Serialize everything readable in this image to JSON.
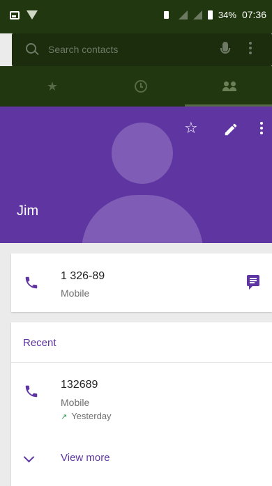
{
  "status_bar": {
    "battery": "34%",
    "time": "07:36"
  },
  "search": {
    "placeholder": "Search contacts"
  },
  "tabs": [
    {
      "icon": "star-icon",
      "selected": false
    },
    {
      "icon": "clock-icon",
      "selected": false
    },
    {
      "icon": "people-icon",
      "selected": true
    }
  ],
  "contact": {
    "name": "Jim"
  },
  "phone_entry": {
    "number": "1 326-89",
    "type": "Mobile"
  },
  "recent": {
    "title": "Recent",
    "call": {
      "number": "132689",
      "type": "Mobile",
      "time": "Yesterday",
      "direction": "outgoing"
    },
    "view_more": "View more"
  },
  "colors": {
    "primary": "#5f35a1",
    "top_bar": "#21370f",
    "outgoing_arrow": "#2e9e4f"
  }
}
